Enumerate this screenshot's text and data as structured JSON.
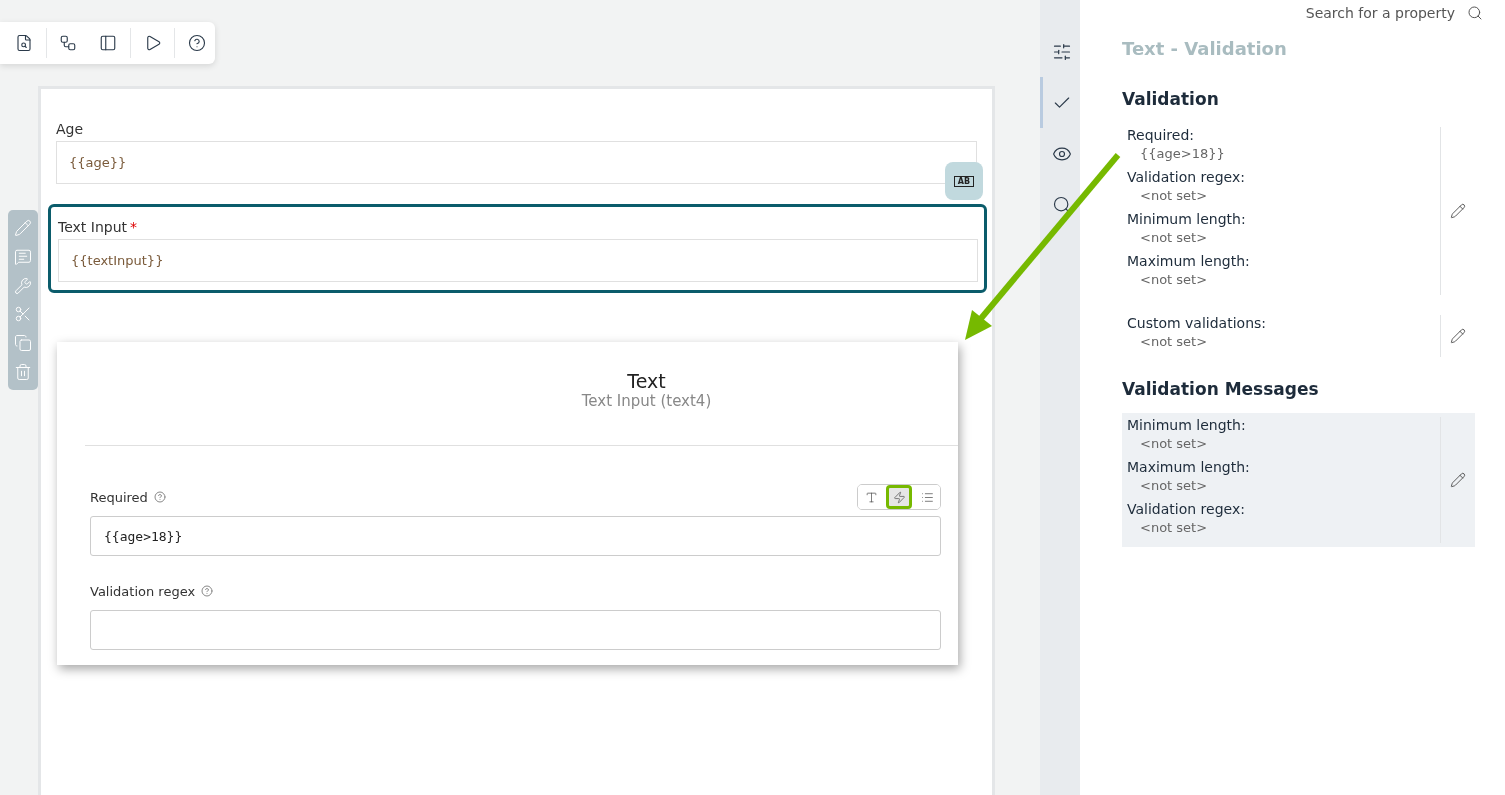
{
  "form": {
    "fields": [
      {
        "label": "Age",
        "value": "{{age}}",
        "selected": false
      },
      {
        "label": "Text Input",
        "value": "{{textInput}}",
        "required_mark": "*",
        "selected": true
      }
    ],
    "type_badge": "AB"
  },
  "dialog": {
    "title": "Text",
    "subtitle": "Text Input (text4)",
    "fields": [
      {
        "label": "Required",
        "value": "{{age>18}}",
        "modes": [
          {
            "kind": "text",
            "selected": false
          },
          {
            "kind": "expression",
            "selected": true
          },
          {
            "kind": "list",
            "selected": false
          }
        ]
      },
      {
        "label": "Validation regex"
      }
    ]
  },
  "rail": [
    {
      "kind": "settings",
      "selected": false
    },
    {
      "kind": "validation",
      "selected": true
    },
    {
      "kind": "visibility",
      "selected": false
    },
    {
      "kind": "search",
      "selected": false
    }
  ],
  "panel": {
    "search": {
      "placeholder": "Search for a property"
    },
    "title": "Text - Validation",
    "sections": [
      {
        "heading": "Validation",
        "groups": [
          {
            "items": [
              {
                "label": "Required:",
                "value": "{{age>18}}"
              },
              {
                "label": "Validation regex:",
                "value": "<not set>"
              },
              {
                "label": "Minimum length:",
                "value": "<not set>"
              },
              {
                "label": "Maximum length:",
                "value": "<not set>"
              }
            ]
          },
          {
            "items": [
              {
                "label": "Custom validations:",
                "value": "<not set>"
              }
            ]
          }
        ]
      },
      {
        "heading": "Validation Messages",
        "groups": [
          {
            "shaded": true,
            "items": [
              {
                "label": "Minimum length:",
                "value": "<not set>"
              },
              {
                "label": "Maximum length:",
                "value": "<not set>"
              },
              {
                "label": "Validation regex:",
                "value": "<not set>"
              }
            ]
          }
        ]
      }
    ]
  }
}
